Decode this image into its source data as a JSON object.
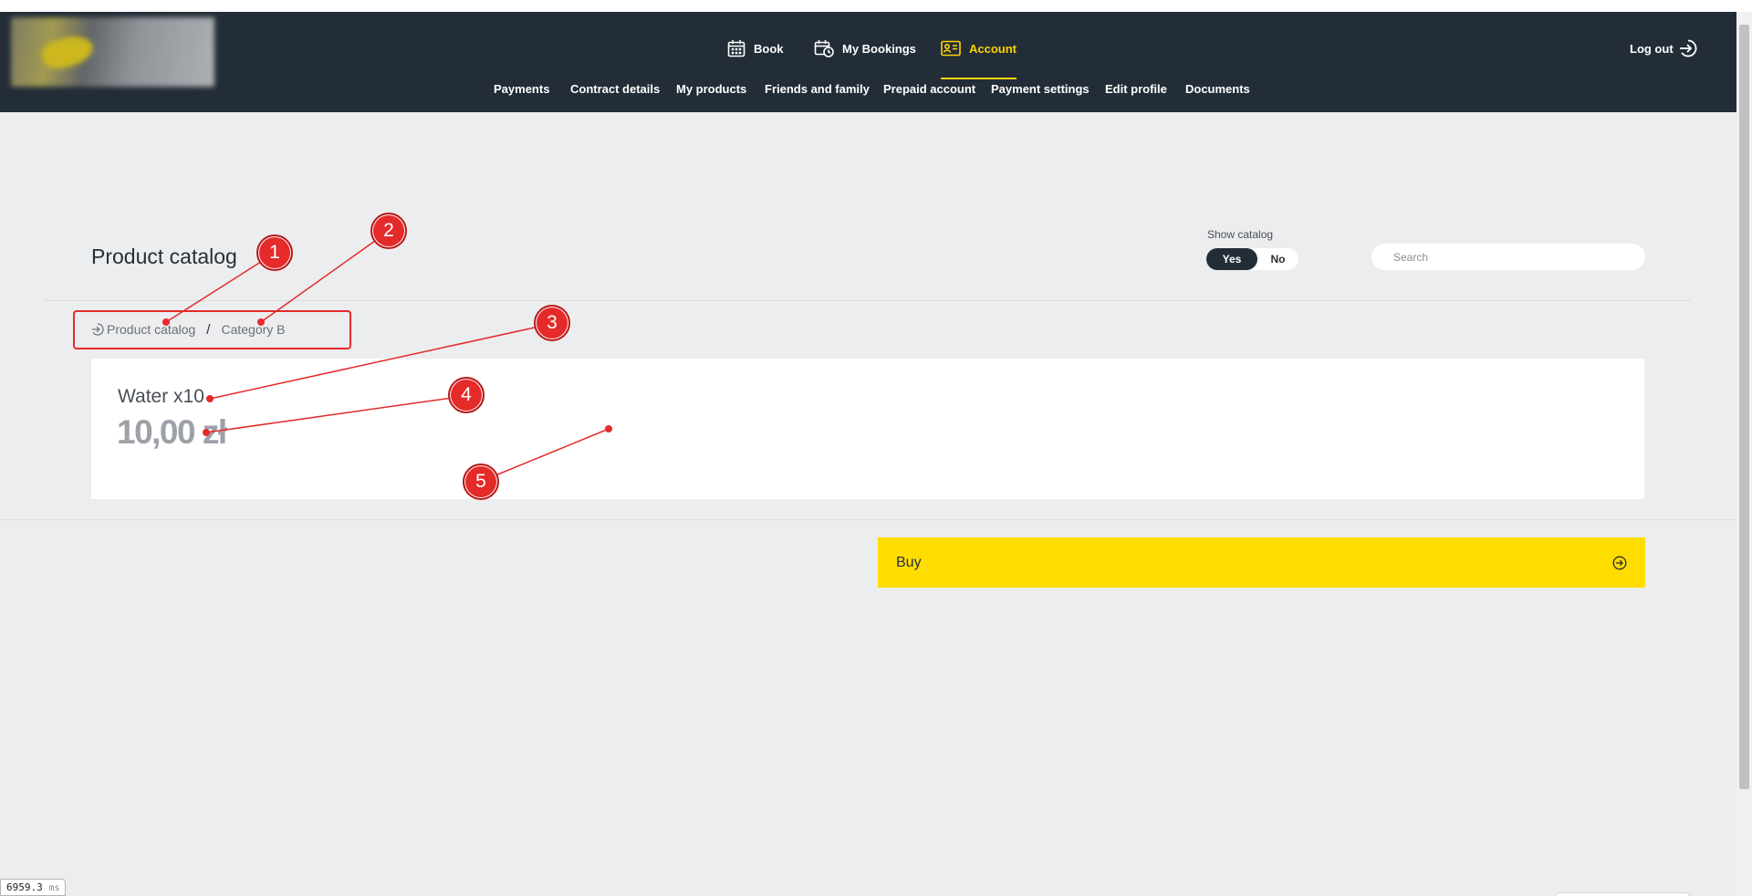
{
  "nav": {
    "logo_label": "Logo",
    "items": [
      {
        "label": "Book",
        "icon": "calendar-icon"
      },
      {
        "label": "My Bookings",
        "icon": "calendar-clock-icon"
      },
      {
        "label": "Account",
        "icon": "id-card-icon",
        "active": true
      }
    ],
    "logout_label": "Log out",
    "logout_icon": "logout-arrow-icon",
    "active_color": "#ffd400"
  },
  "subnav": {
    "items": [
      {
        "label": "Payments"
      },
      {
        "label": "Contract details"
      },
      {
        "label": "My products"
      },
      {
        "label": "Friends and family"
      },
      {
        "label": "Prepaid account"
      },
      {
        "label": "Payment settings"
      },
      {
        "label": "Edit profile"
      },
      {
        "label": "Documents"
      }
    ]
  },
  "page": {
    "title": "Product catalog",
    "show_catalog": {
      "label": "Show catalog",
      "options": [
        "Yes",
        "No"
      ],
      "selected": "Yes"
    },
    "search": {
      "placeholder": "Search",
      "value": ""
    }
  },
  "breadcrumb": {
    "items": [
      {
        "label": "Product catalog",
        "icon": "back-arrow-circle-icon"
      },
      {
        "label": "Category B"
      }
    ],
    "separator": "/"
  },
  "product": {
    "name": "Water x10",
    "price": "10,00 zł"
  },
  "buy_button": {
    "label": "Buy",
    "icon": "arrow-right-circle-icon",
    "color": "#ffdd00"
  },
  "annotations": [
    {
      "number": "1"
    },
    {
      "number": "2"
    },
    {
      "number": "3"
    },
    {
      "number": "4"
    },
    {
      "number": "5"
    }
  ],
  "debug_timer": {
    "value": "6959.3",
    "unit": "ms"
  },
  "colors": {
    "navbar_bg": "#232d38",
    "page_bg": "#ecedee",
    "annotation_red": "#e52a2a"
  }
}
